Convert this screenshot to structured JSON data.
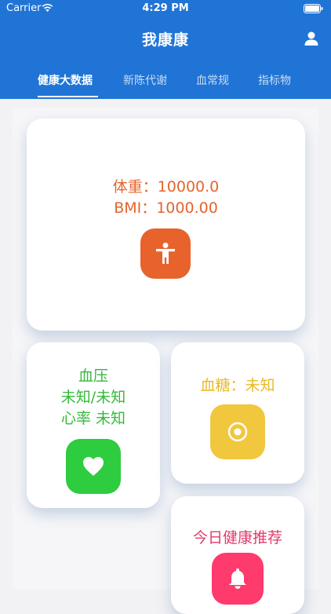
{
  "status_bar": {
    "carrier": "Carrier",
    "time": "4:29 PM"
  },
  "header": {
    "title": "我康康"
  },
  "tabs": [
    {
      "label": "健康大数据"
    },
    {
      "label": "新陈代谢"
    },
    {
      "label": "血常规"
    },
    {
      "label": "指标物"
    }
  ],
  "weight_card": {
    "weight": "体重：10000.0",
    "bmi": "BMI：1000.00"
  },
  "bp_card": {
    "title": "血压",
    "value": "未知/未知",
    "heart_rate": "心率 未知"
  },
  "sugar_card": {
    "label": "血糖：未知"
  },
  "recommend_card": {
    "label": "今日健康推荐"
  },
  "icons": {
    "profile": "profile-icon",
    "weight": "person-icon",
    "bp": "heart-icon",
    "sugar": "target-icon",
    "recommend": "bell-icon"
  },
  "colors": {
    "header": "#1f74d6",
    "weight": "#e8622c",
    "bp": "#2ecc3f",
    "sugar": "#f1c73e",
    "recommend": "#ff3a6c"
  }
}
